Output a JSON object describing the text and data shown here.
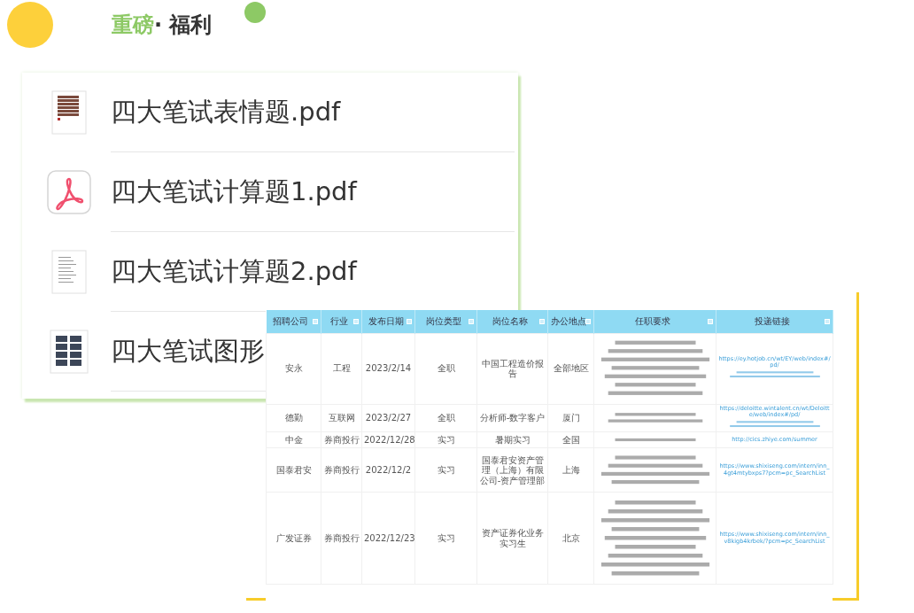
{
  "title": {
    "highlight": "重磅",
    "separator": "·",
    "rest": "福利"
  },
  "files": [
    {
      "name": "四大笔试表情题.pdf",
      "kind": "sheet"
    },
    {
      "name": "四大笔试计算题1.pdf",
      "kind": "acrobat"
    },
    {
      "name": "四大笔试计算题2.pdf",
      "kind": "doc"
    },
    {
      "name": "四大笔试图形",
      "kind": "grid"
    }
  ],
  "table": {
    "columns": [
      "招聘公司",
      "行业",
      "发布日期",
      "岗位类型",
      "岗位名称",
      "办公地点",
      "任职要求",
      "投递链接"
    ],
    "rows": [
      {
        "cells": [
          "安永",
          "工程",
          "2023/2/14",
          "全职",
          "中国工程造价报告",
          "全部地区"
        ],
        "link": "https://ey.hotjob.cn/wt/EY/web/index#/pd/",
        "link_blurred": true
      },
      {
        "cells": [
          "德勤",
          "互联网",
          "2023/2/27",
          "全职",
          "分析师-数字客户",
          "厦门"
        ],
        "link": "https://deloitte.wintalent.cn/wt/Deloitte/web/index#/pd/",
        "link_blurred": true
      },
      {
        "cells": [
          "中金",
          "券商投行",
          "2022/12/28",
          "实习",
          "暑期实习",
          "全国"
        ],
        "link": "http://cics.zhiye.com/summer",
        "link_blurred": false
      },
      {
        "cells": [
          "国泰君安",
          "券商投行",
          "2022/12/2",
          "实习",
          "国泰君安资产管理（上海）有限公司-资产管理部",
          "上海"
        ],
        "link": "https://www.shixiseng.com/intern/inn_4gt4mtybxps7?pcm=pc_SearchList",
        "link_blurred": false
      },
      {
        "cells": [
          "广发证券",
          "券商投行",
          "2022/12/23",
          "实习",
          "资产证券化业务实习生",
          "北京"
        ],
        "link": "https://www.shixiseng.com/intern/inn_v8kigb4krbek/?pcm=pc_SearchList",
        "link_blurred": false
      }
    ]
  }
}
